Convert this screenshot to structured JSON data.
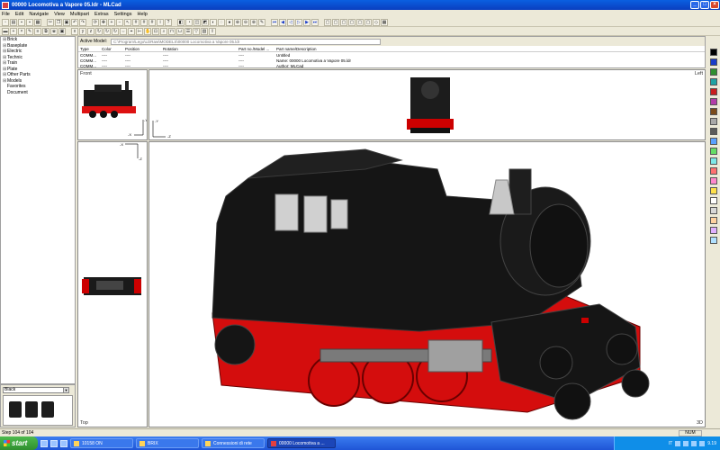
{
  "window": {
    "title": "00000 Locomotiva a Vapore 05.ldr - MLCad"
  },
  "menu": [
    "File",
    "Edit",
    "Navigate",
    "View",
    "Multipart",
    "Extras",
    "Settings",
    "Help"
  ],
  "parts_tree": [
    {
      "label": "Brick",
      "expandable": true
    },
    {
      "label": "Baseplate",
      "expandable": true
    },
    {
      "label": "Electric",
      "expandable": true
    },
    {
      "label": "Technic",
      "expandable": true
    },
    {
      "label": "Train",
      "expandable": true
    },
    {
      "label": "Plate",
      "expandable": true
    },
    {
      "label": "Other Parts",
      "expandable": true
    },
    {
      "label": "Models",
      "expandable": true
    },
    {
      "label": "Favorites",
      "expandable": false
    },
    {
      "label": "Document",
      "expandable": false
    }
  ],
  "brick_selector": {
    "color": "Black"
  },
  "model_panel": {
    "active_model_label": "Active Model:",
    "active_model_path": "C:\\Program\\Lego\\LDRaw\\MODELS\\00000 Locomotiva a Vapore 05.ldr",
    "columns": [
      "Type",
      "Color",
      "Position",
      "Rotation",
      "Part no./Model ...",
      "Part name/Description"
    ],
    "rows": [
      [
        "COMM...",
        "----",
        "----",
        "----",
        "----",
        "Untitled"
      ],
      [
        "COMM...",
        "----",
        "----",
        "----",
        "----",
        "Name: 00000 Locomotiva a Vapore 05.ldr"
      ],
      [
        "COMM...",
        "----",
        "----",
        "----",
        "----",
        "Author: MLCad"
      ]
    ]
  },
  "views": {
    "front": "Front",
    "left": "Left",
    "top": "Top",
    "3d": "3D",
    "axis_labels": {
      "x": "-X",
      "y": "-Y",
      "z": "-Z"
    }
  },
  "status": {
    "step": "Step 104 of 104",
    "num": "NUM"
  },
  "taskbar": {
    "start": "start",
    "tasks": [
      "10158 ON",
      "BRIX",
      "Connessioni di rete",
      "00000 Locomotiva a ..."
    ],
    "language": "IT",
    "clock": "9.19"
  },
  "palette_colors": [
    "#000000",
    "#1a3cc8",
    "#2f8f2f",
    "#1fa3a3",
    "#c81e1e",
    "#b23ea8",
    "#7a4a1a",
    "#a8a8a8",
    "#5a5a5a",
    "#5aa0ff",
    "#66dd66",
    "#7ee8e8",
    "#ff7070",
    "#ff88cc",
    "#ffe14a",
    "#ffffff",
    "#d8d8d8",
    "#ffd2a0",
    "#e0b0ff",
    "#b0e0ff"
  ]
}
